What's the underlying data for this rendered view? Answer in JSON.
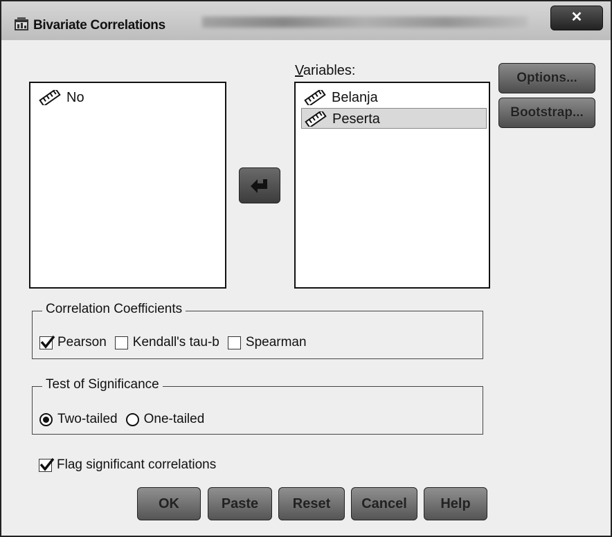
{
  "window": {
    "title": "Bivariate Correlations",
    "close_glyph": "✕"
  },
  "source_list": {
    "items": [
      {
        "label": "No",
        "icon": "scale-ruler-icon"
      }
    ]
  },
  "variables": {
    "label": "Variables:",
    "items": [
      {
        "label": "Belanja",
        "icon": "scale-ruler-icon",
        "selected": false
      },
      {
        "label": "Peserta",
        "icon": "scale-ruler-icon",
        "selected": true
      }
    ]
  },
  "move_button": {
    "icon": "arrow-left-icon"
  },
  "side_buttons": {
    "options": "Options...",
    "bootstrap": "Bootstrap..."
  },
  "correlation_coefficients": {
    "title": "Correlation Coefficients",
    "pearson": {
      "label": "Pearson",
      "checked": true
    },
    "kendall": {
      "label": "Kendall's tau-b",
      "checked": false
    },
    "spearman": {
      "label": "Spearman",
      "checked": false
    }
  },
  "test_of_significance": {
    "title": "Test of Significance",
    "two_tailed": {
      "label": "Two-tailed",
      "selected": true
    },
    "one_tailed": {
      "label": "One-tailed",
      "selected": false
    }
  },
  "flag": {
    "label": "Flag significant correlations",
    "checked": true
  },
  "bottom_buttons": {
    "ok": "OK",
    "paste": "Paste",
    "reset": "Reset",
    "cancel": "Cancel",
    "help": "Help"
  },
  "colors": {
    "dialog_bg": "#eeeeee",
    "selection": "#d9d9d9",
    "button_dark": "#555555"
  }
}
